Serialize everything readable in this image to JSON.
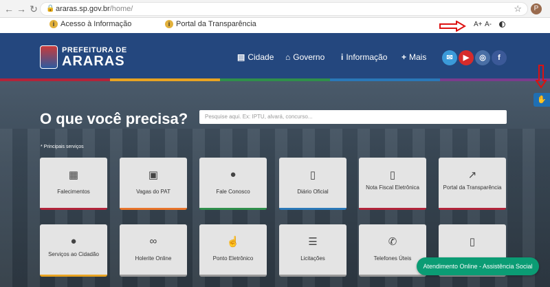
{
  "browser": {
    "url_host": "araras.sp.gov.br",
    "url_path": "/home/",
    "profile_initial": "P"
  },
  "topbar": {
    "acesso_label": "Acesso à Informação",
    "portal_label": "Portal da Transparência",
    "font_increase": "A+",
    "font_decrease": "A-"
  },
  "header": {
    "logo_line1": "PREFEITURA DE",
    "logo_line2": "ARARAS",
    "menu": [
      {
        "label": "Cidade",
        "icon": "building-icon"
      },
      {
        "label": "Governo",
        "icon": "institution-icon"
      },
      {
        "label": "Informação",
        "icon": "info-icon"
      },
      {
        "label": "Mais",
        "icon": "plus-icon"
      }
    ],
    "social": [
      {
        "name": "email",
        "color": "#3b9ad9"
      },
      {
        "name": "youtube",
        "color": "#d62b2b"
      },
      {
        "name": "instagram",
        "color": "#4a6fa5"
      },
      {
        "name": "facebook",
        "color": "#3b5998"
      }
    ]
  },
  "hero": {
    "headline": "O que você precisa?",
    "search_placeholder": "Pesquise aqui. Ex: IPTU, alvará, concurso...",
    "principais": "* Principais serviços"
  },
  "services": [
    {
      "label": "Falecimentos",
      "icon": "grid-icon",
      "color": "#b2243a"
    },
    {
      "label": "Vagas do PAT",
      "icon": "briefcase-icon",
      "color": "#e8742a"
    },
    {
      "label": "Fale Conosco",
      "icon": "chat-icon",
      "color": "#2f8f4b"
    },
    {
      "label": "Diário Oficial",
      "icon": "document-icon",
      "color": "#2a78b8"
    },
    {
      "label": "Nota Fiscal Eletrônica",
      "icon": "invoice-icon",
      "color": "#b2243a"
    },
    {
      "label": "Portal da Transparência",
      "icon": "external-link-icon",
      "color": "#b2243a"
    },
    {
      "label": "Serviços ao Cidadão",
      "icon": "user-icon",
      "color": "#e8a322"
    },
    {
      "label": "Holerite Online",
      "icon": "link-icon",
      "color": "#999999"
    },
    {
      "label": "Ponto Eletrônico",
      "icon": "hand-pointer-icon",
      "color": "#999999"
    },
    {
      "label": "Licitações",
      "icon": "list-icon",
      "color": "#999999"
    },
    {
      "label": "Telefones Úteis",
      "icon": "phone-icon",
      "color": "#999999"
    },
    {
      "label": "",
      "icon": "document-icon",
      "color": "#999999"
    }
  ],
  "chat": {
    "label": "Atendimento Online - Assistência Social"
  }
}
